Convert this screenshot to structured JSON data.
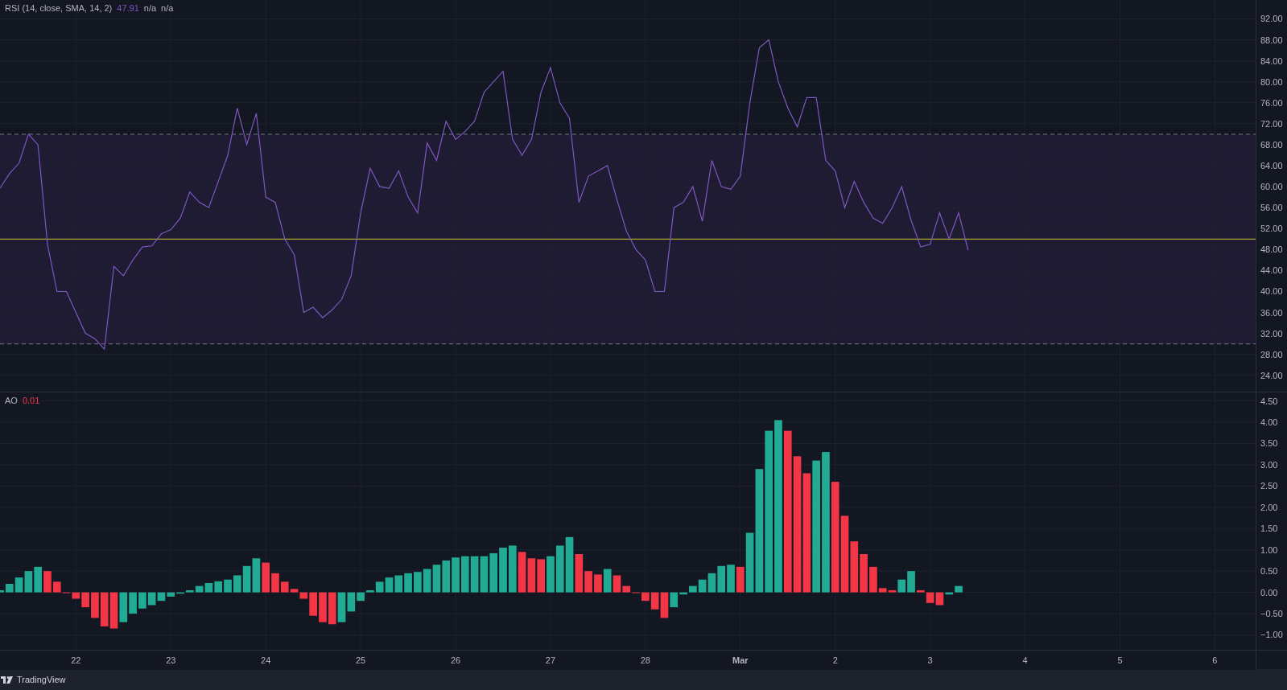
{
  "rsi_pane": {
    "legend": {
      "name": "RSI (14, close, SMA, 14, 2)",
      "value": "47.91",
      "extra": [
        "n/a",
        "n/a"
      ]
    },
    "chart_data": {
      "type": "line",
      "ylim": [
        20.9,
        95.6
      ],
      "yticks": [
        {
          "value": 92,
          "label": "92.00"
        },
        {
          "value": 88,
          "label": "88.00"
        },
        {
          "value": 84,
          "label": "84.00"
        },
        {
          "value": 80,
          "label": "80.00"
        },
        {
          "value": 76,
          "label": "76.00"
        },
        {
          "value": 72,
          "label": "72.00"
        },
        {
          "value": 68,
          "label": "68.00"
        },
        {
          "value": 64,
          "label": "64.00"
        },
        {
          "value": 60,
          "label": "60.00"
        },
        {
          "value": 56,
          "label": "56.00"
        },
        {
          "value": 52,
          "label": "52.00"
        },
        {
          "value": 48,
          "label": "48.00"
        },
        {
          "value": 44,
          "label": "44.00"
        },
        {
          "value": 40,
          "label": "40.00"
        },
        {
          "value": 36,
          "label": "36.00"
        },
        {
          "value": 32,
          "label": "32.00"
        },
        {
          "value": 28,
          "label": "28.00"
        },
        {
          "value": 24,
          "label": "24.00"
        }
      ],
      "grid": true,
      "bands": [
        {
          "axis": "y",
          "from": 30,
          "to": 70
        }
      ],
      "ref_lines": [
        {
          "axis": "y",
          "value": 70
        },
        {
          "axis": "y",
          "value": 50
        },
        {
          "axis": "y",
          "value": 30
        }
      ],
      "categories": [
        null,
        null,
        null,
        null,
        null,
        null,
        null,
        null,
        null,
        null,
        null,
        null,
        null,
        null,
        null,
        null,
        null,
        null,
        null,
        null,
        null,
        null,
        null,
        null,
        null,
        null,
        null,
        null,
        null,
        null,
        null,
        null,
        null,
        null,
        null,
        null,
        null,
        null,
        null,
        null,
        null,
        null,
        null,
        null,
        null,
        null,
        null,
        null,
        null,
        null,
        null,
        null,
        null,
        null,
        null,
        null,
        null,
        null,
        null,
        null,
        null,
        null,
        null,
        null,
        null,
        null,
        null,
        null,
        null,
        null,
        null,
        null,
        null,
        null,
        null,
        null,
        null,
        null,
        null,
        null,
        null,
        null,
        null,
        null,
        null,
        null,
        null,
        null,
        null,
        null,
        null,
        null,
        null,
        null,
        null,
        null,
        null,
        null,
        null,
        null,
        null,
        null,
        null
      ],
      "series": [
        {
          "color": "#7e57c2",
          "values": [
            59.7,
            62.5,
            64.5,
            70,
            68,
            49,
            40,
            40,
            36,
            32,
            31,
            29,
            44.8,
            43,
            46,
            48.5,
            48.7,
            51,
            51.8,
            54,
            59,
            57,
            56,
            61,
            66,
            75,
            68,
            74,
            58,
            57,
            50,
            47,
            36,
            37,
            35,
            36.5,
            38.5,
            43,
            55,
            63.5,
            60,
            59.7,
            63,
            58,
            55,
            68.3,
            65,
            72.5,
            69,
            70.5,
            72.5,
            78,
            80,
            82,
            69,
            66,
            69,
            78,
            82.7,
            76,
            73,
            57,
            62,
            63,
            64,
            57.5,
            51.5,
            48,
            46,
            40,
            40,
            56,
            57,
            60,
            53.4,
            65,
            60,
            59.5,
            62,
            76,
            86.5,
            88,
            80,
            75,
            71.4,
            77,
            77,
            65,
            63,
            56,
            61,
            57,
            54,
            53,
            56,
            60,
            53.5,
            48.5,
            49,
            55,
            50,
            55,
            47.9
          ]
        }
      ]
    }
  },
  "ao_pane": {
    "legend": {
      "name": "AO",
      "value": "0.01"
    },
    "chart_data": {
      "type": "bar",
      "grid": true,
      "xlim": [
        "--02-21T04:48",
        "--03-06T18:14"
      ],
      "ylim": [
        -1.35,
        4.7
      ],
      "xticks": [
        {
          "value": "--02-22",
          "label": "22"
        },
        {
          "value": "--02-23",
          "label": "23"
        },
        {
          "value": "--02-24",
          "label": "24"
        },
        {
          "value": "--02-25",
          "label": "25"
        },
        {
          "value": "--02-26",
          "label": "26"
        },
        {
          "value": "--02-27",
          "label": "27"
        },
        {
          "value": "--02-28",
          "label": "28"
        },
        {
          "value": "--03-01",
          "label": "Mar"
        },
        {
          "value": "--03-02",
          "label": "2"
        },
        {
          "value": "--03-03",
          "label": "3"
        },
        {
          "value": "--03-04",
          "label": "4"
        },
        {
          "value": "--03-05",
          "label": "5"
        },
        {
          "value": "--03-06",
          "label": "6"
        }
      ],
      "yticks": [
        {
          "value": 4.5,
          "label": "4.50"
        },
        {
          "value": 4,
          "label": "4.00"
        },
        {
          "value": 3.5,
          "label": "3.50"
        },
        {
          "value": 3,
          "label": "3.00"
        },
        {
          "value": 2.5,
          "label": "2.50"
        },
        {
          "value": 2,
          "label": "2.00"
        },
        {
          "value": 1.5,
          "label": "1.50"
        },
        {
          "value": 1,
          "label": "1.00"
        },
        {
          "value": 0.5,
          "label": "0.50"
        },
        {
          "value": 0,
          "label": "0.00"
        },
        {
          "value": -0.5,
          "label": "−0.50"
        },
        {
          "value": -1,
          "label": "−1.00"
        }
      ],
      "x": [
        "--02-21T04:48",
        "--02-21T07:12",
        "--02-21T09:36",
        "--02-21T12:00",
        "--02-21T14:24",
        "--02-21T16:48",
        "--02-21T19:12",
        "--02-21T21:36",
        "--02-22T00:00",
        "--02-22T02:24",
        "--02-22T04:48",
        "--02-22T07:12",
        "--02-22T09:36",
        "--02-22T12:00",
        "--02-22T14:24",
        "--02-22T16:48",
        "--02-22T19:12",
        "--02-22T21:36",
        "--02-23T00:00",
        "--02-23T02:24",
        "--02-23T04:48",
        "--02-23T07:12",
        "--02-23T09:36",
        "--02-23T12:00",
        "--02-23T14:24",
        "--02-23T16:48",
        "--02-23T19:12",
        "--02-23T21:36",
        "--02-24T00:00",
        "--02-24T02:24",
        "--02-24T04:48",
        "--02-24T07:12",
        "--02-24T09:36",
        "--02-24T12:00",
        "--02-24T14:24",
        "--02-24T16:48",
        "--02-24T19:12",
        "--02-24T21:36",
        "--02-25T00:00",
        "--02-25T02:24",
        "--02-25T04:48",
        "--02-25T07:12",
        "--02-25T09:36",
        "--02-25T12:00",
        "--02-25T14:24",
        "--02-25T16:48",
        "--02-25T19:12",
        "--02-25T21:36",
        "--02-26T00:00",
        "--02-26T02:24",
        "--02-26T04:48",
        "--02-26T07:12",
        "--02-26T09:36",
        "--02-26T12:00",
        "--02-26T14:24",
        "--02-26T16:48",
        "--02-26T19:12",
        "--02-26T21:36",
        "--02-27T00:00",
        "--02-27T02:24",
        "--02-27T04:48",
        "--02-27T07:12",
        "--02-27T09:36",
        "--02-27T12:00",
        "--02-27T14:24",
        "--02-27T16:48",
        "--02-27T19:12",
        "--02-27T21:36",
        "--02-28T00:00",
        "--02-28T02:24",
        "--02-28T04:48",
        "--02-28T07:12",
        "--02-28T09:36",
        "--02-28T12:00",
        "--02-28T14:24",
        "--02-28T16:48",
        "--02-28T19:12",
        "--02-28T21:36",
        "--03-01T00:00",
        "--03-01T02:24",
        "--03-01T04:48",
        "--03-01T07:12",
        "--03-01T09:36",
        "--03-01T12:00",
        "--03-01T14:24",
        "--03-01T16:48",
        "--03-01T19:12",
        "--03-01T21:36",
        "--03-02T00:00",
        "--03-02T02:24",
        "--03-02T04:48",
        "--03-02T07:12",
        "--03-02T09:36",
        "--03-02T12:00",
        "--03-02T14:24",
        "--03-02T16:48",
        "--03-02T19:12",
        "--03-02T21:36",
        "--03-03T00:00",
        "--03-03T02:24",
        "--03-03T04:48",
        "--03-03T07:12"
      ],
      "series": [
        {
          "color": "#22ab94",
          "values": [
            0.05,
            0.2,
            0.35,
            0.5,
            0.6,
            null,
            null,
            null,
            null,
            null,
            null,
            null,
            null,
            -0.7,
            -0.5,
            -0.38,
            -0.3,
            -0.2,
            -0.1,
            -0.03,
            0.05,
            0.15,
            0.22,
            0.26,
            0.3,
            0.4,
            0.62,
            0.8,
            null,
            null,
            null,
            null,
            null,
            null,
            null,
            null,
            -0.7,
            -0.45,
            -0.2,
            0.05,
            0.25,
            0.35,
            0.4,
            0.45,
            0.48,
            0.55,
            0.65,
            0.75,
            0.82,
            0.85,
            0.85,
            0.85,
            0.92,
            1.05,
            1.1,
            null,
            null,
            null,
            0.85,
            1.1,
            1.3,
            null,
            null,
            null,
            0.55,
            null,
            null,
            null,
            null,
            null,
            null,
            -0.35,
            -0.05,
            0.15,
            0.3,
            0.45,
            0.62,
            0.65,
            null,
            1.4,
            2.9,
            3.8,
            4.05,
            null,
            null,
            null,
            3.1,
            3.3,
            null,
            null,
            null,
            null,
            null,
            null,
            null,
            0.3,
            0.5,
            null,
            null,
            null,
            -0.05,
            0.15
          ]
        },
        {
          "color": "#f23645",
          "values": [
            null,
            null,
            null,
            null,
            null,
            0.5,
            0.25,
            0.0,
            -0.15,
            -0.35,
            -0.6,
            -0.8,
            -0.85,
            null,
            null,
            null,
            null,
            null,
            null,
            null,
            null,
            null,
            null,
            null,
            null,
            null,
            null,
            null,
            0.7,
            0.45,
            0.25,
            0.08,
            -0.15,
            -0.55,
            -0.7,
            -0.75,
            null,
            null,
            null,
            null,
            null,
            null,
            null,
            null,
            null,
            null,
            null,
            null,
            null,
            null,
            null,
            null,
            null,
            null,
            null,
            0.95,
            0.8,
            0.78,
            null,
            null,
            null,
            0.9,
            0.5,
            0.42,
            null,
            0.4,
            0.15,
            0.0,
            -0.2,
            -0.4,
            -0.6,
            null,
            null,
            null,
            null,
            null,
            null,
            null,
            0.6,
            null,
            null,
            null,
            null,
            3.8,
            3.2,
            2.8,
            null,
            null,
            2.6,
            1.8,
            1.2,
            0.9,
            0.6,
            0.1,
            0.05,
            null,
            null,
            0.05,
            -0.25,
            -0.3,
            null,
            null
          ]
        }
      ]
    }
  },
  "footer": {
    "brand": "TradingView"
  }
}
